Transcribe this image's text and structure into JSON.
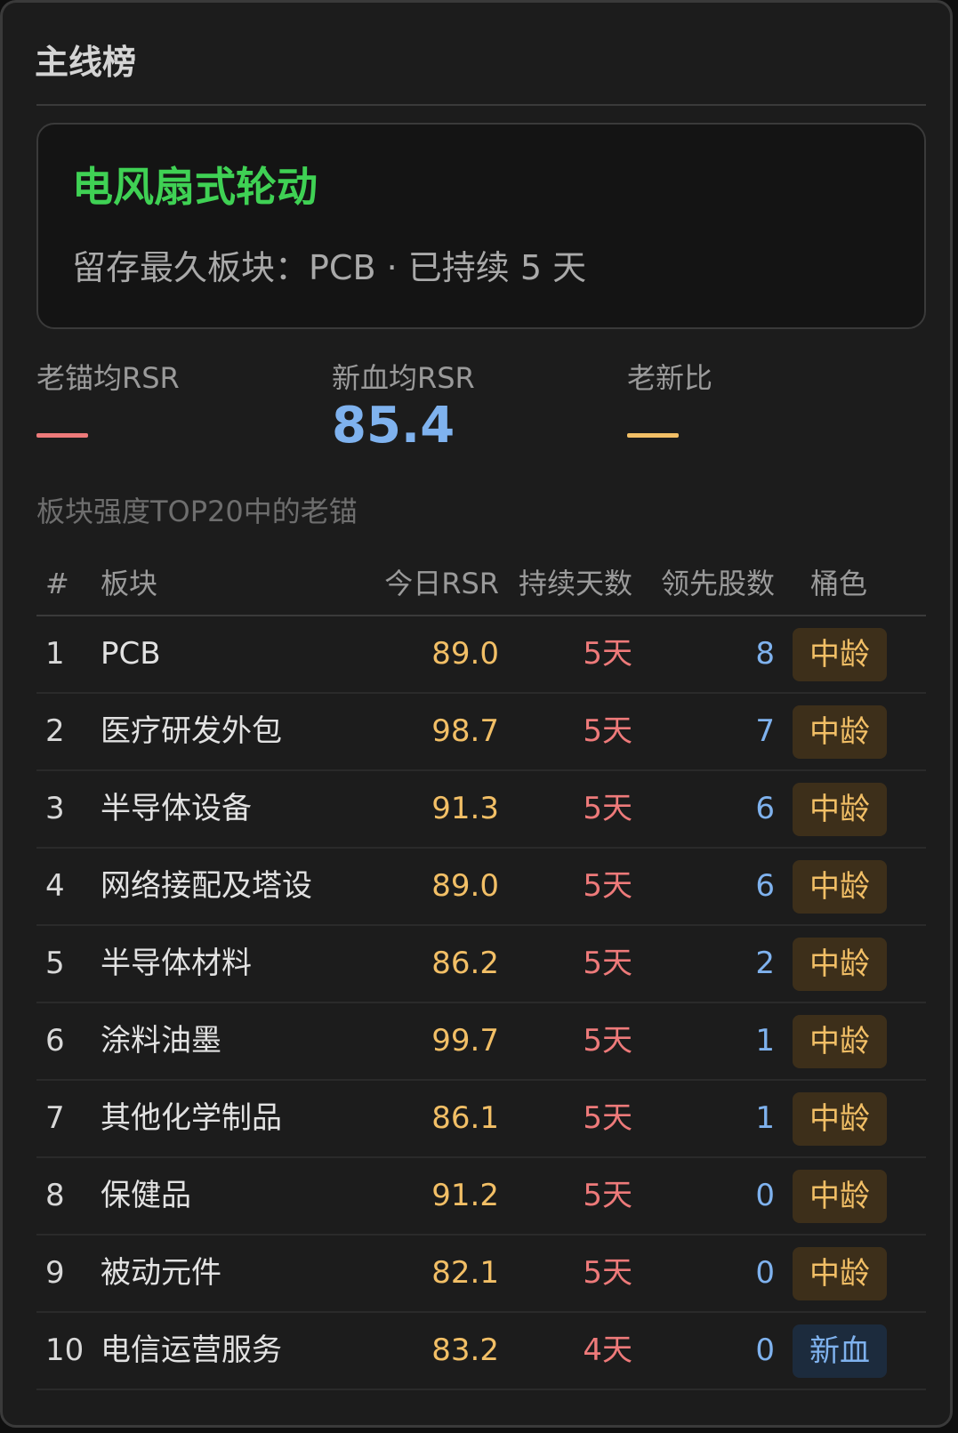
{
  "header": {
    "title": "主线榜"
  },
  "summary": {
    "title": "电风扇式轮动",
    "subtitle": "留存最久板块：PCB · 已持续 5 天"
  },
  "stats": [
    {
      "label": "老锚均RSR",
      "value": "—",
      "color": "#ee7a7a"
    },
    {
      "label": "新血均RSR",
      "value": "85.4",
      "color": "#7fb2ee"
    },
    {
      "label": "老新比",
      "value": "—",
      "color": "#f2bf66"
    }
  ],
  "section_label": "板块强度TOP20中的老锚",
  "table": {
    "headers": {
      "rank": "#",
      "name": "板块",
      "rsr": "今日RSR",
      "days": "持续天数",
      "leaders": "领先股数",
      "bucket": "桶色"
    },
    "rows": [
      {
        "rank": "1",
        "name": "PCB",
        "rsr": "89.0",
        "days": "5天",
        "leaders": "8",
        "bucket": "中龄"
      },
      {
        "rank": "2",
        "name": "医疗研发外包",
        "rsr": "98.7",
        "days": "5天",
        "leaders": "7",
        "bucket": "中龄"
      },
      {
        "rank": "3",
        "name": "半导体设备",
        "rsr": "91.3",
        "days": "5天",
        "leaders": "6",
        "bucket": "中龄"
      },
      {
        "rank": "4",
        "name": "网络接配及塔设",
        "rsr": "89.0",
        "days": "5天",
        "leaders": "6",
        "bucket": "中龄"
      },
      {
        "rank": "5",
        "name": "半导体材料",
        "rsr": "86.2",
        "days": "5天",
        "leaders": "2",
        "bucket": "中龄"
      },
      {
        "rank": "6",
        "name": "涂料油墨",
        "rsr": "99.7",
        "days": "5天",
        "leaders": "1",
        "bucket": "中龄"
      },
      {
        "rank": "7",
        "name": "其他化学制品",
        "rsr": "86.1",
        "days": "5天",
        "leaders": "1",
        "bucket": "中龄"
      },
      {
        "rank": "8",
        "name": "保健品",
        "rsr": "91.2",
        "days": "5天",
        "leaders": "0",
        "bucket": "中龄"
      },
      {
        "rank": "9",
        "name": "被动元件",
        "rsr": "82.1",
        "days": "5天",
        "leaders": "0",
        "bucket": "中龄"
      },
      {
        "rank": "10",
        "name": "电信运营服务",
        "rsr": "83.2",
        "days": "4天",
        "leaders": "0",
        "bucket": "新血"
      }
    ]
  },
  "colors": {
    "accent_green": "#3fd154",
    "bucket_mid_bg": "#3d2f1a",
    "bucket_mid_fg": "#f2bf66",
    "bucket_new_bg": "#1c2b3d",
    "bucket_new_fg": "#7fb2ee"
  }
}
